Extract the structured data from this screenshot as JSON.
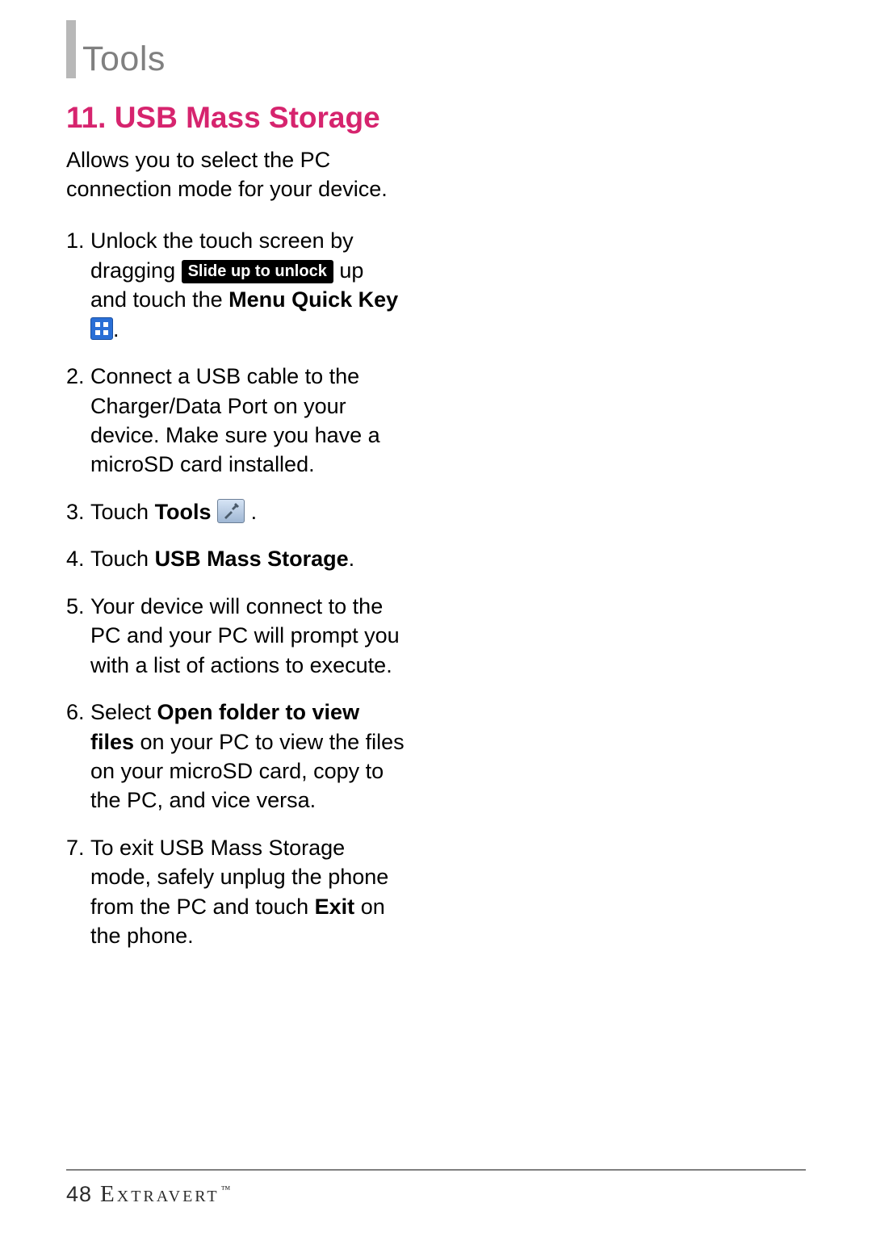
{
  "chapter": "Tools",
  "section": {
    "number": "11.",
    "title": "USB Mass Storage"
  },
  "intro": "Allows you to select the PC connection mode for your device.",
  "steps": {
    "s1": {
      "a": "Unlock the touch screen by dragging ",
      "chip": "Slide up to unlock",
      "b": " up and touch the ",
      "bold": "Menu Quick Key",
      "c": " ",
      "d": "."
    },
    "s2": "Connect a USB cable to the Charger/Data Port on your device. Make sure you have a microSD card installed.",
    "s3": {
      "a": "Touch ",
      "bold": "Tools",
      "b": " ",
      "c": " ."
    },
    "s4": {
      "a": "Touch ",
      "bold": "USB Mass Storage",
      "b": "."
    },
    "s5": "Your device will connect to the PC and your PC will prompt you with a list of actions to execute.",
    "s6": {
      "a": "Select ",
      "bold": "Open folder to view files",
      "b": " on your PC to view the files on your microSD card, copy to the PC, and vice versa."
    },
    "s7": {
      "a": "To exit USB Mass Storage mode, safely unplug the phone from the PC and touch ",
      "bold": "Exit",
      "b": " on the phone."
    }
  },
  "footer": {
    "page": "48",
    "brand": "Extravert",
    "tm": "™"
  }
}
